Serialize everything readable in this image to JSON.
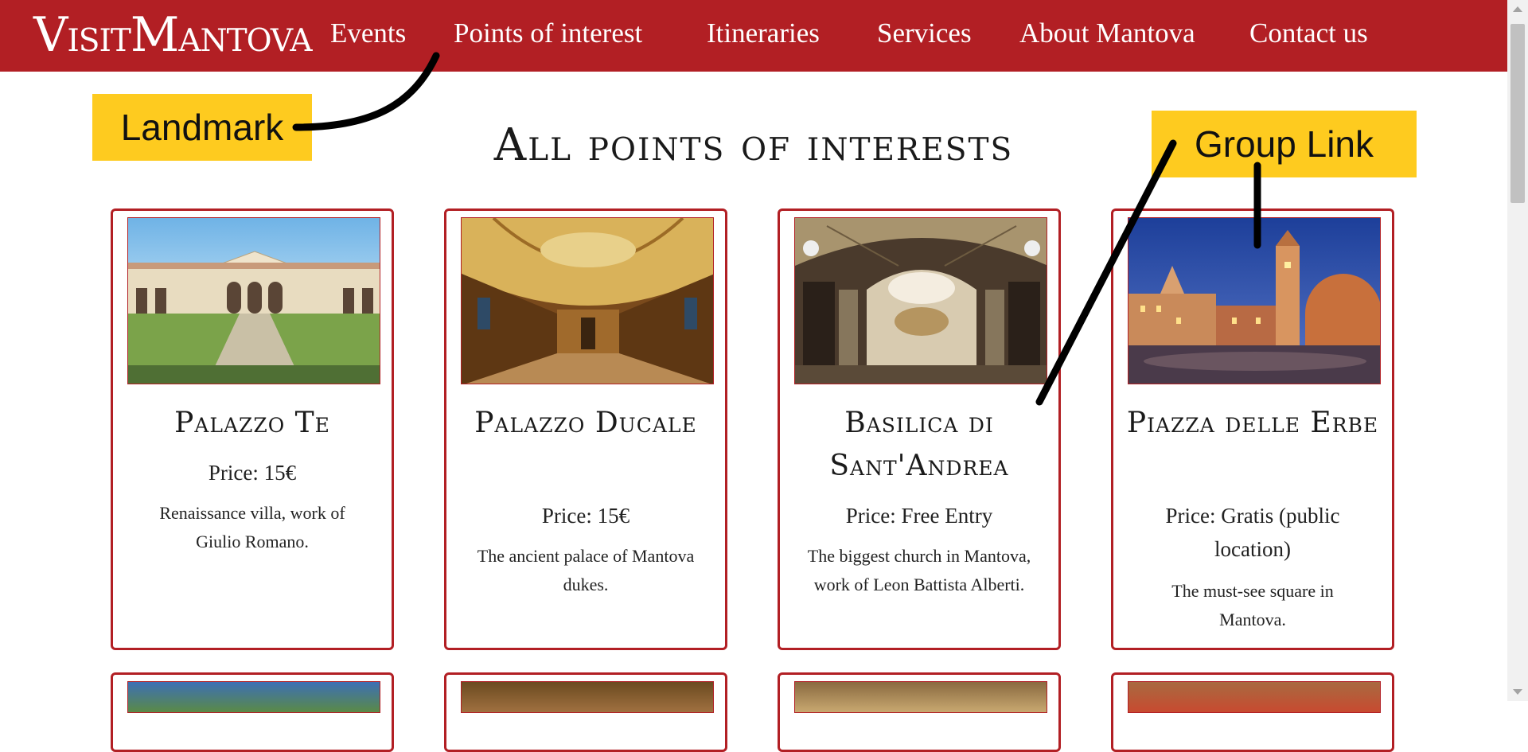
{
  "brand": {
    "logo_text_part1": "V",
    "logo_text_part2": "ISIT",
    "logo_text_part3": "M",
    "logo_text_part4": "ANTOVA"
  },
  "nav": {
    "items": [
      {
        "label": "Events"
      },
      {
        "label": "Points of interest"
      },
      {
        "label": "Itineraries"
      },
      {
        "label": "Services"
      },
      {
        "label": "About Mantova"
      },
      {
        "label": "Contact us"
      }
    ]
  },
  "page": {
    "title": "All points of interests"
  },
  "cards": [
    {
      "title": "Palazzo Te",
      "price": "Price: 15€",
      "description": "Renaissance villa, work of Giulio Romano."
    },
    {
      "title": "Palazzo Ducale",
      "price": "Price: 15€",
      "description": "The ancient palace of Mantova dukes."
    },
    {
      "title": "Basilica di Sant'Andrea",
      "price": "Price: Free Entry",
      "description": "The biggest church in Mantova, work of Leon Battista Alberti."
    },
    {
      "title": "Piazza delle Erbe",
      "price": "Price: Gratis (public location)",
      "description": "The must-see square in Mantova."
    }
  ],
  "annotations": {
    "landmark_label": "Landmark",
    "group_link_label": "Group Link"
  },
  "colors": {
    "brand_red": "#b21f24",
    "callout_yellow": "#fecb1f"
  }
}
